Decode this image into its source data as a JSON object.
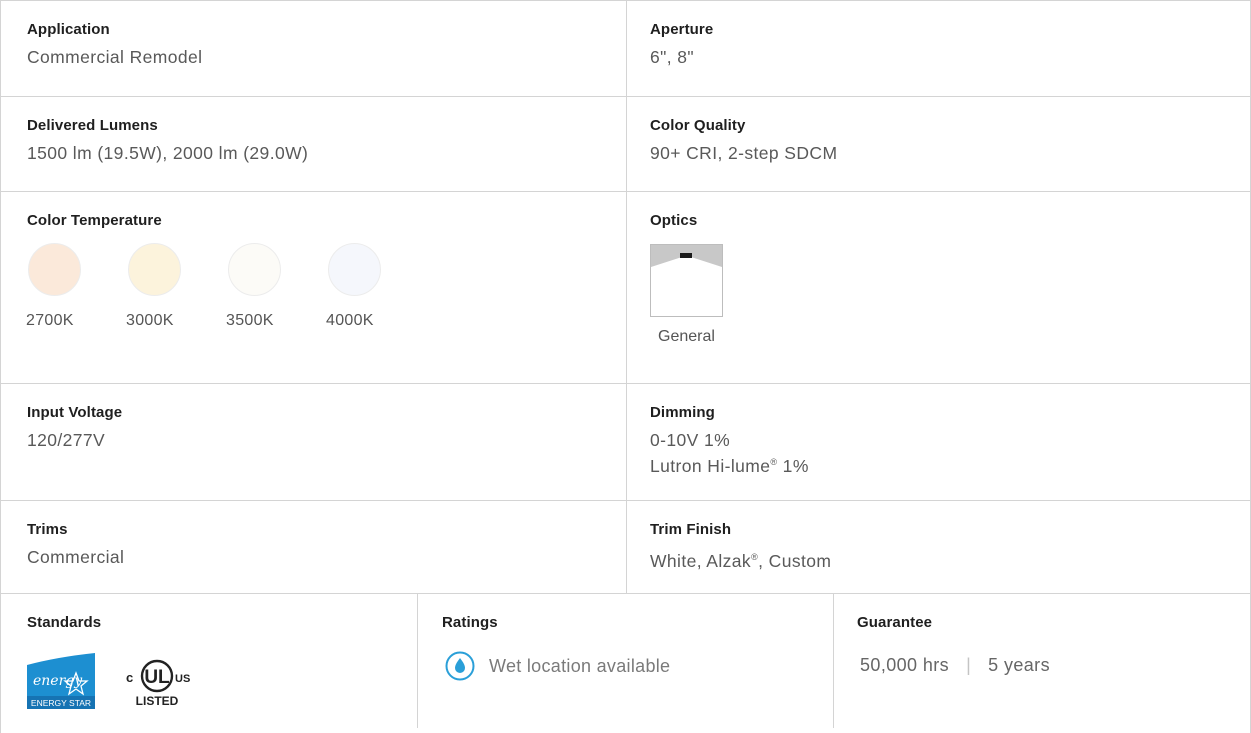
{
  "application": {
    "label": "Application",
    "value": "Commercial Remodel"
  },
  "aperture": {
    "label": "Aperture",
    "value": "6\", 8\""
  },
  "lumens": {
    "label": "Delivered Lumens",
    "value": "1500 lm (19.5W), 2000 lm (29.0W)"
  },
  "color_quality": {
    "label": "Color Quality",
    "value": "90+ CRI, 2-step SDCM"
  },
  "color_temperature": {
    "label": "Color Temperature",
    "options": [
      {
        "name": "2700K",
        "color": "#fbe9da"
      },
      {
        "name": "3000K",
        "color": "#fcf3dc"
      },
      {
        "name": "3500K",
        "color": "#fcfbf7"
      },
      {
        "name": "4000K",
        "color": "#f5f7fc"
      }
    ]
  },
  "optics": {
    "label": "Optics",
    "option": "General",
    "icon": "general-optic-icon"
  },
  "input_voltage": {
    "label": "Input Voltage",
    "value": "120/277V"
  },
  "dimming": {
    "label": "Dimming",
    "line1": "0-10V 1%",
    "line2_pre": "Lutron Hi-lume",
    "line2_sup": "®",
    "line2_post": " 1%"
  },
  "trims": {
    "label": "Trims",
    "value": "Commercial"
  },
  "trim_finish": {
    "label": "Trim Finish",
    "pre": "White, Alzak",
    "sup": "®",
    "post": ", Custom"
  },
  "standards": {
    "label": "Standards",
    "energy_star_text": "ENERGY STAR",
    "energy_star_script": "energy",
    "ul_mark": "UL",
    "ul_left": "c",
    "ul_right": "US",
    "ul_listed": "LISTED"
  },
  "ratings": {
    "label": "Ratings",
    "value": "Wet location available",
    "icon": "water-drop-icon",
    "accent": "#2a9fd8"
  },
  "guarantee": {
    "label": "Guarantee",
    "hours": "50,000 hrs",
    "separator": "|",
    "years": "5 years"
  }
}
